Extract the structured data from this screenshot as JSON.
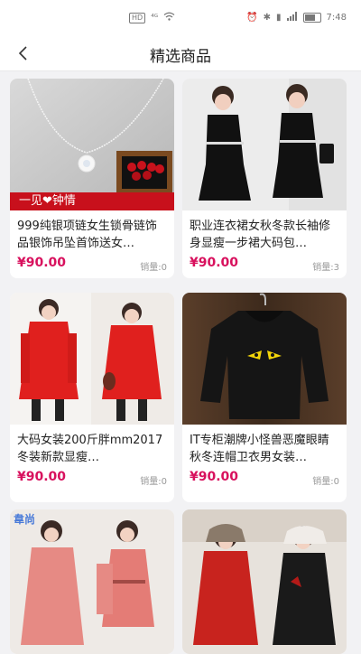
{
  "status_bar": {
    "left": "HD ᯤ",
    "right_icons": "⏰ ✱ ▮",
    "time": "7:48"
  },
  "header": {
    "title": "精选商品",
    "back_icon": "chevron-left-icon"
  },
  "products": [
    {
      "name": "999纯银项链女生锁骨链饰品银饰吊坠首饰送女…",
      "price": "¥90.00",
      "sales": "销量:0",
      "banner": "一见❤钟情"
    },
    {
      "name": "职业连衣裙女秋冬款长袖修身显瘦一步裙大码包…",
      "price": "¥90.00",
      "sales": "销量:3"
    },
    {
      "name": "大码女装200斤胖mm2017冬装新款显瘦…",
      "price": "¥90.00",
      "sales": "销量:0"
    },
    {
      "name": "IT专柜潮牌小怪兽恶魔眼睛秋冬连帽卫衣男女装…",
      "price": "¥90.00",
      "sales": "销量:0"
    },
    {
      "name": "",
      "price": "",
      "sales": "",
      "watermark": "韋尚"
    },
    {
      "name": "",
      "price": "",
      "sales": ""
    }
  ],
  "colors": {
    "price": "#d8105d",
    "background": "#f2f2f4"
  }
}
